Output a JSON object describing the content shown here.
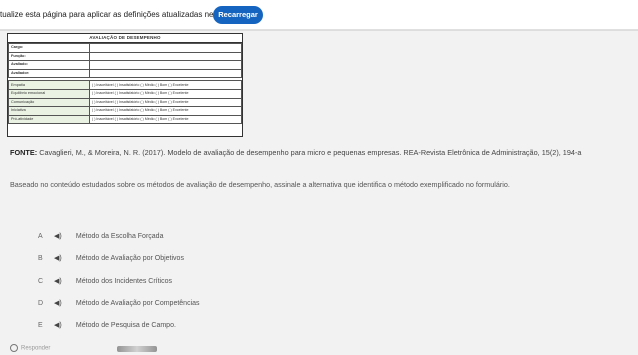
{
  "topbar": {
    "message": "tualize esta página para aplicar as definições atualizadas neste site",
    "reload_label": "Recarregar"
  },
  "form": {
    "title": "AVALIAÇÃO DE DESEMPENHO",
    "fields": [
      "Cargo:",
      "Função:",
      "Avaliado:",
      "Avaliador:"
    ],
    "criteria": [
      {
        "name": "Empatia",
        "options": "( ) Inaceitável ( ) Insatisfatório ( ) Médio ( ) Bom ( ) Excelente"
      },
      {
        "name": "Equilíbrio emocional",
        "options": "( ) Inaceitável ( ) Insatisfatório ( ) Médio ( ) Bom ( ) Excelente"
      },
      {
        "name": "Comunicação",
        "options": "( ) Inaceitável ( ) Insatisfatório ( ) Médio ( ) Bom ( ) Excelente"
      },
      {
        "name": "Iniciativa",
        "options": "( ) Inaceitável ( ) Insatisfatório ( ) Médio ( ) Bom ( ) Excelente"
      },
      {
        "name": "Pró-atividade",
        "options": "( ) Inaceitável ( ) Insatisfatório ( ) Médio ( ) Bom ( ) Excelente"
      }
    ]
  },
  "reference": {
    "label": "FONTE:",
    "text": "Cavaglieri, M., & Moreira, N. R. (2017). Modelo de avaliação de desempenho para micro e pequenas empresas. REA-Revista Eletrônica de Administração, 15(2), 194-a"
  },
  "question": "Baseado no conteúdo estudados sobre os métodos de avaliação de desempenho, assinale a alternativa que identifica o método exemplificado no formulário.",
  "options": [
    {
      "letter": "A",
      "text": "Método da Escolha Forçada"
    },
    {
      "letter": "B",
      "text": "Método de Avaliação por Objetivos"
    },
    {
      "letter": "C",
      "text": "Método dos Incidentes Críticos"
    },
    {
      "letter": "D",
      "text": "Método de Avaliação por Competências"
    },
    {
      "letter": "E",
      "text": "Método de Pesquisa de Campo."
    }
  ],
  "audio_icon": "speaker-icon",
  "bottom": {
    "label": "Responder"
  }
}
